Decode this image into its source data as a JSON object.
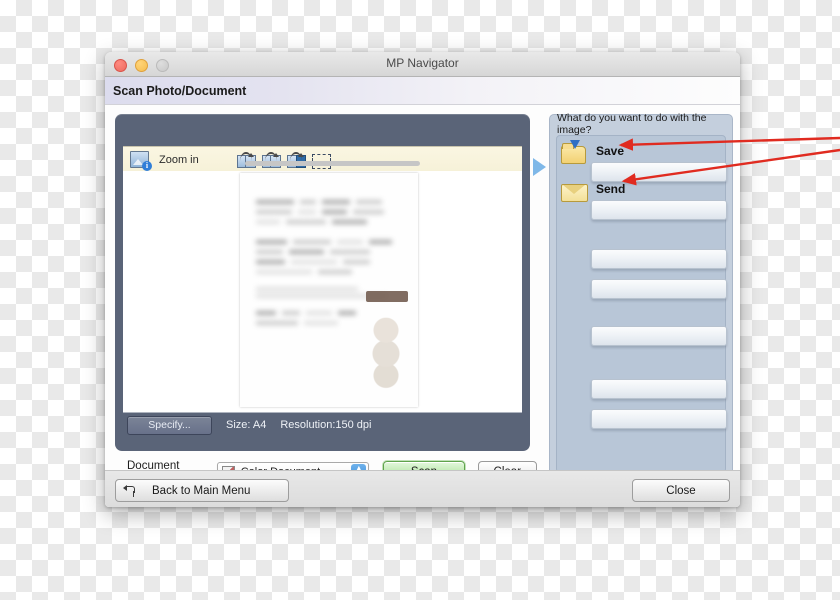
{
  "window": {
    "title": "MP Navigator",
    "traffic_lights": [
      "close-red",
      "minimize-yellow",
      "zoom-disabled-grey"
    ],
    "subheader_title": "Scan Photo/Document"
  },
  "scan_panel": {
    "toolbar": {
      "zoom_icon": "image-info-icon",
      "zoom_label": "Zoom in",
      "tools": [
        {
          "name": "rotate-left-icon"
        },
        {
          "name": "rotate-right-icon"
        },
        {
          "name": "mirror-flip-icon"
        },
        {
          "name": "crop-selection-icon"
        }
      ]
    },
    "preview": {
      "alt": "blurred scanned document preview"
    },
    "info_bar": {
      "specify_label": "Specify...",
      "size_text": "Size: A4",
      "resolution_text": "Resolution:150 dpi"
    }
  },
  "doctype_row": {
    "label": "Document Type:",
    "selected": "Color Document",
    "swatch_icon": "color-swatch-icon",
    "stepper_icon": "stepper-arrows-icon",
    "scan_label": "Scan",
    "clear_label": "Clear"
  },
  "flow_arrow": {
    "icon": "flow-arrow-right-icon"
  },
  "right_panel": {
    "header": "What do you want to do with the image?",
    "actions": [
      {
        "icon": "save-folder-icon",
        "label": "Save"
      },
      {
        "icon": "send-envelope-icon",
        "label": "Send"
      }
    ],
    "empty_slots": 6
  },
  "bottom_bar": {
    "back_icon": "back-arrow-icon",
    "back_label": "Back to Main Menu",
    "close_label": "Close"
  },
  "annotations": {
    "arrow_color": "#e02b20",
    "arrows": [
      {
        "name": "arrow-to-save",
        "target": "Save"
      },
      {
        "name": "arrow-to-send",
        "target": "Send"
      }
    ]
  }
}
